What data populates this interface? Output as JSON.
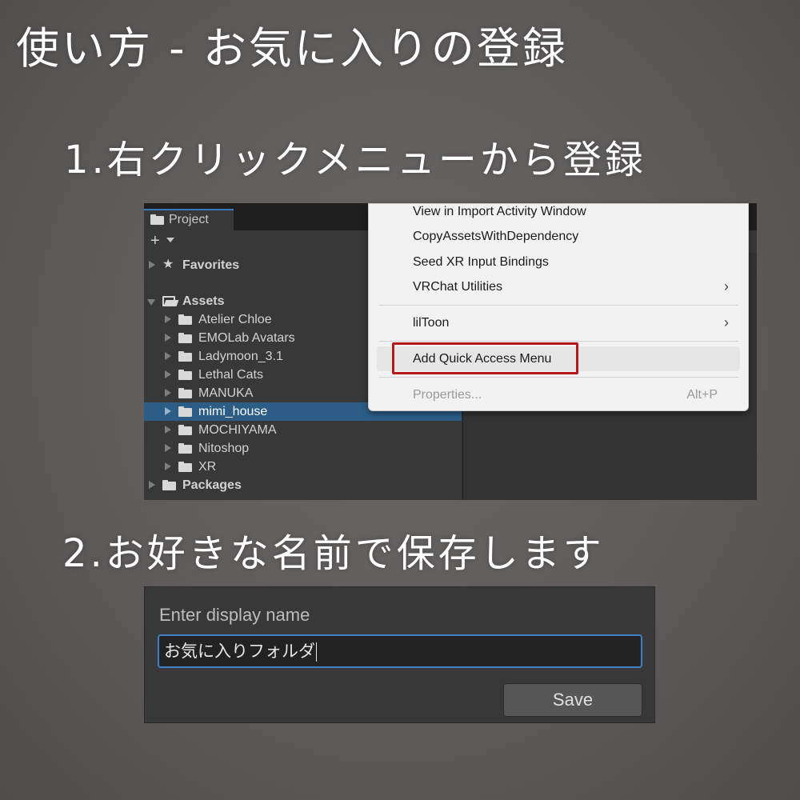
{
  "titles": {
    "main": "使い方 - お気に入りの登録",
    "step1": "1.右クリックメニューから登録",
    "step2": "2.お好きな名前で保存します"
  },
  "project_panel": {
    "tab_label": "Project",
    "plus_label": "+",
    "favorites_label": "Favorites",
    "assets_label": "Assets",
    "folders": [
      "Atelier Chloe",
      "EMOLab Avatars",
      "Ladymoon_3.1",
      "Lethal Cats",
      "MANUKA",
      "mimi_house",
      "MOCHIYAMA",
      "Nitoshop",
      "XR"
    ],
    "selected_folder": "mimi_house",
    "packages_label": "Packages"
  },
  "context_menu": {
    "items": [
      "View in Import Activity Window",
      "CopyAssetsWithDependency",
      "Seed XR Input Bindings",
      "VRChat Utilities",
      "lilToon",
      "Add Quick Access Menu",
      "Properties..."
    ],
    "submenu_chevron": "›",
    "properties_shortcut": "Alt+P",
    "highlighted_item": "Add Quick Access Menu",
    "highlight_color": "#b51a1a"
  },
  "name_dialog": {
    "label": "Enter display name",
    "input_value": "お気に入りフォルダ",
    "save_label": "Save"
  },
  "colors": {
    "selection": "#2c5d87",
    "input_focus": "#3d7fc8"
  }
}
